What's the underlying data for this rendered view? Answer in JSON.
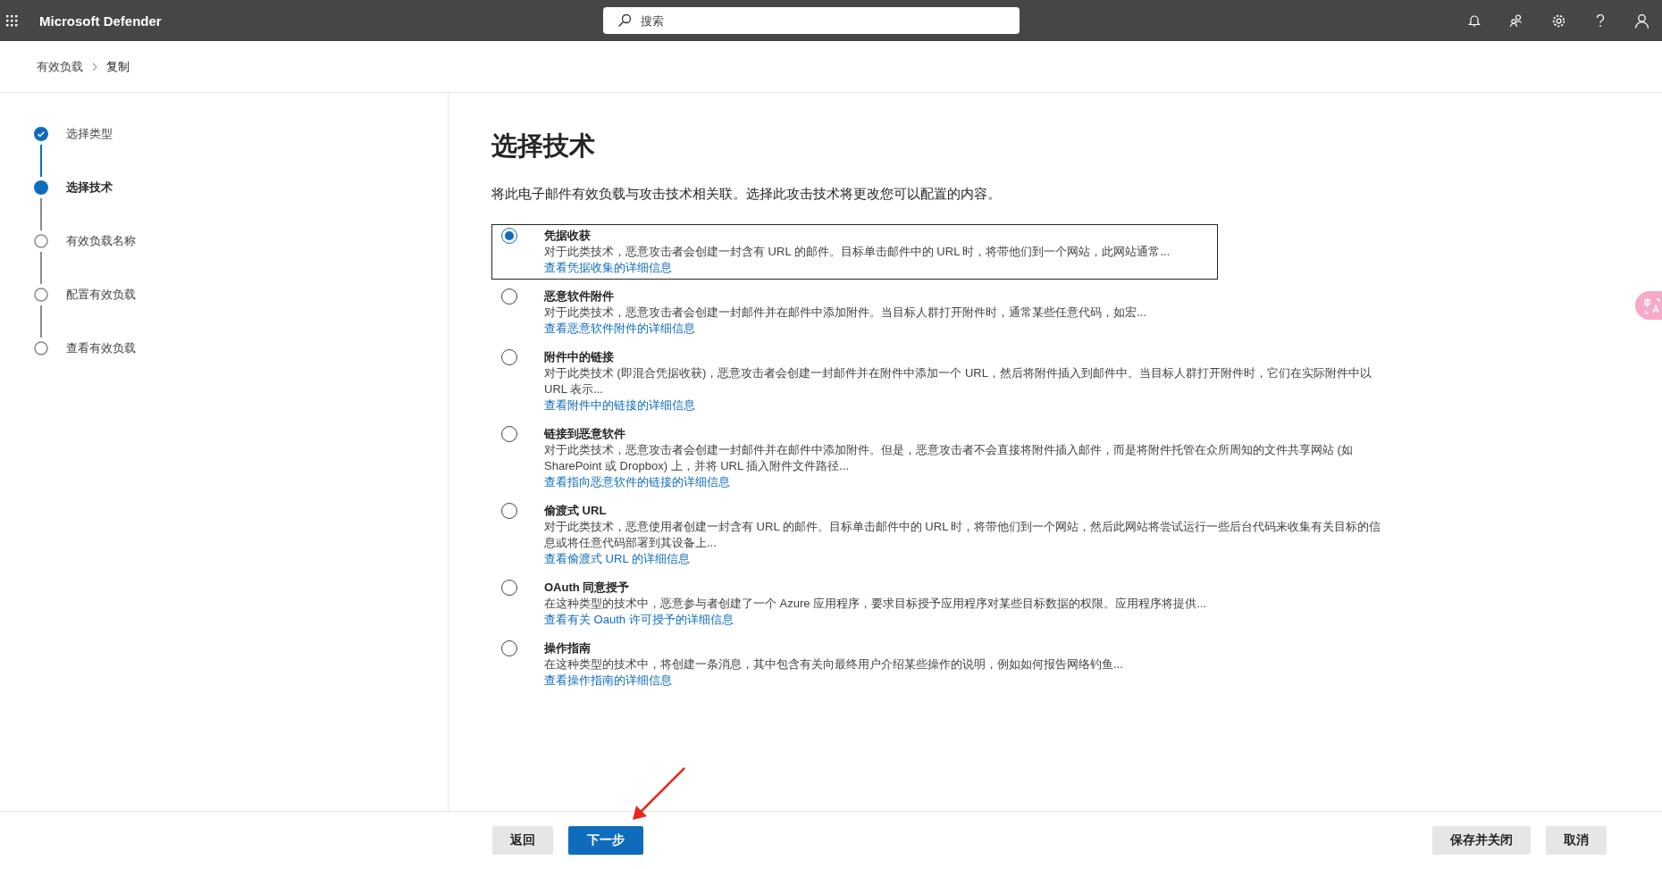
{
  "app_bar": {
    "title": "Microsoft Defender",
    "search": {
      "placeholder": "搜索"
    }
  },
  "breadcrumb": [
    "有效负载",
    "复制"
  ],
  "steps": [
    {
      "label": "选择类型",
      "completed": true,
      "selected": false
    },
    {
      "label": "选择技术",
      "completed": false,
      "selected": true
    },
    {
      "label": "有效负载名称",
      "completed": false,
      "selected": false
    },
    {
      "label": "配置有效负载",
      "completed": false,
      "selected": false
    },
    {
      "label": "查看有效负载",
      "completed": false,
      "selected": false
    }
  ],
  "page": {
    "title": "选择技术",
    "description": "将此电子邮件有效负载与攻击技术相关联。选择此攻击技术将更改您可以配置的内容。"
  },
  "techniques": [
    {
      "name": "凭据收获",
      "description": "对于此类技术，恶意攻击者会创建一封含有 URL 的邮件。目标单击邮件中的 URL 时，将带他们到一个网站，此网站通常...",
      "link": "查看凭据收集的详细信息",
      "selected": true
    },
    {
      "name": "恶意软件附件",
      "description": "对于此类技术，恶意攻击者会创建一封邮件并在邮件中添加附件。当目标人群打开附件时，通常某些任意代码，如宏...",
      "link": "查看恶意软件附件的详细信息",
      "selected": false
    },
    {
      "name": "附件中的链接",
      "description": "对于此类技术 (即混合凭据收获)，恶意攻击者会创建一封邮件并在附件中添加一个 URL，然后将附件插入到邮件中。当目标人群打开附件时，它们在实际附件中以 URL 表示...",
      "link": "查看附件中的链接的详细信息",
      "selected": false
    },
    {
      "name": "链接到恶意软件",
      "description": "对于此类技术，恶意攻击者会创建一封邮件并在邮件中添加附件。但是，恶意攻击者不会直接将附件插入邮件，而是将附件托管在众所周知的文件共享网站 (如 SharePoint 或 Dropbox) 上，并将 URL 插入附件文件路径...",
      "link": "查看指向恶意软件的链接的详细信息",
      "selected": false
    },
    {
      "name": "偷渡式 URL",
      "description": "对于此类技术，恶意使用者创建一封含有 URL 的邮件。目标单击邮件中的 URL 时，将带他们到一个网站，然后此网站将尝试运行一些后台代码来收集有关目标的信息或将任意代码部署到其设备上...",
      "link": "查看偷渡式 URL 的详细信息",
      "selected": false
    },
    {
      "name": "OAuth 同意授予",
      "description": "在这种类型的技术中，恶意参与者创建了一个 Azure 应用程序，要求目标授予应用程序对某些目标数据的权限。应用程序将提供...",
      "link": "查看有关 Oauth 许可授予的详细信息",
      "selected": false
    },
    {
      "name": "操作指南",
      "description": "在这种类型的技术中，将创建一条消息，其中包含有关向最终用户介绍某些操作的说明，例如如何报告网络钓鱼...",
      "link": "查看操作指南的详细信息",
      "selected": false
    }
  ],
  "footer": {
    "left_buttons": [
      {
        "label": "返回",
        "kind": "secondary"
      },
      {
        "label": "下一步",
        "kind": "primary"
      }
    ],
    "right_buttons": [
      {
        "label": "保存并关闭",
        "kind": "secondary"
      },
      {
        "label": "取消",
        "kind": "secondary"
      }
    ]
  }
}
